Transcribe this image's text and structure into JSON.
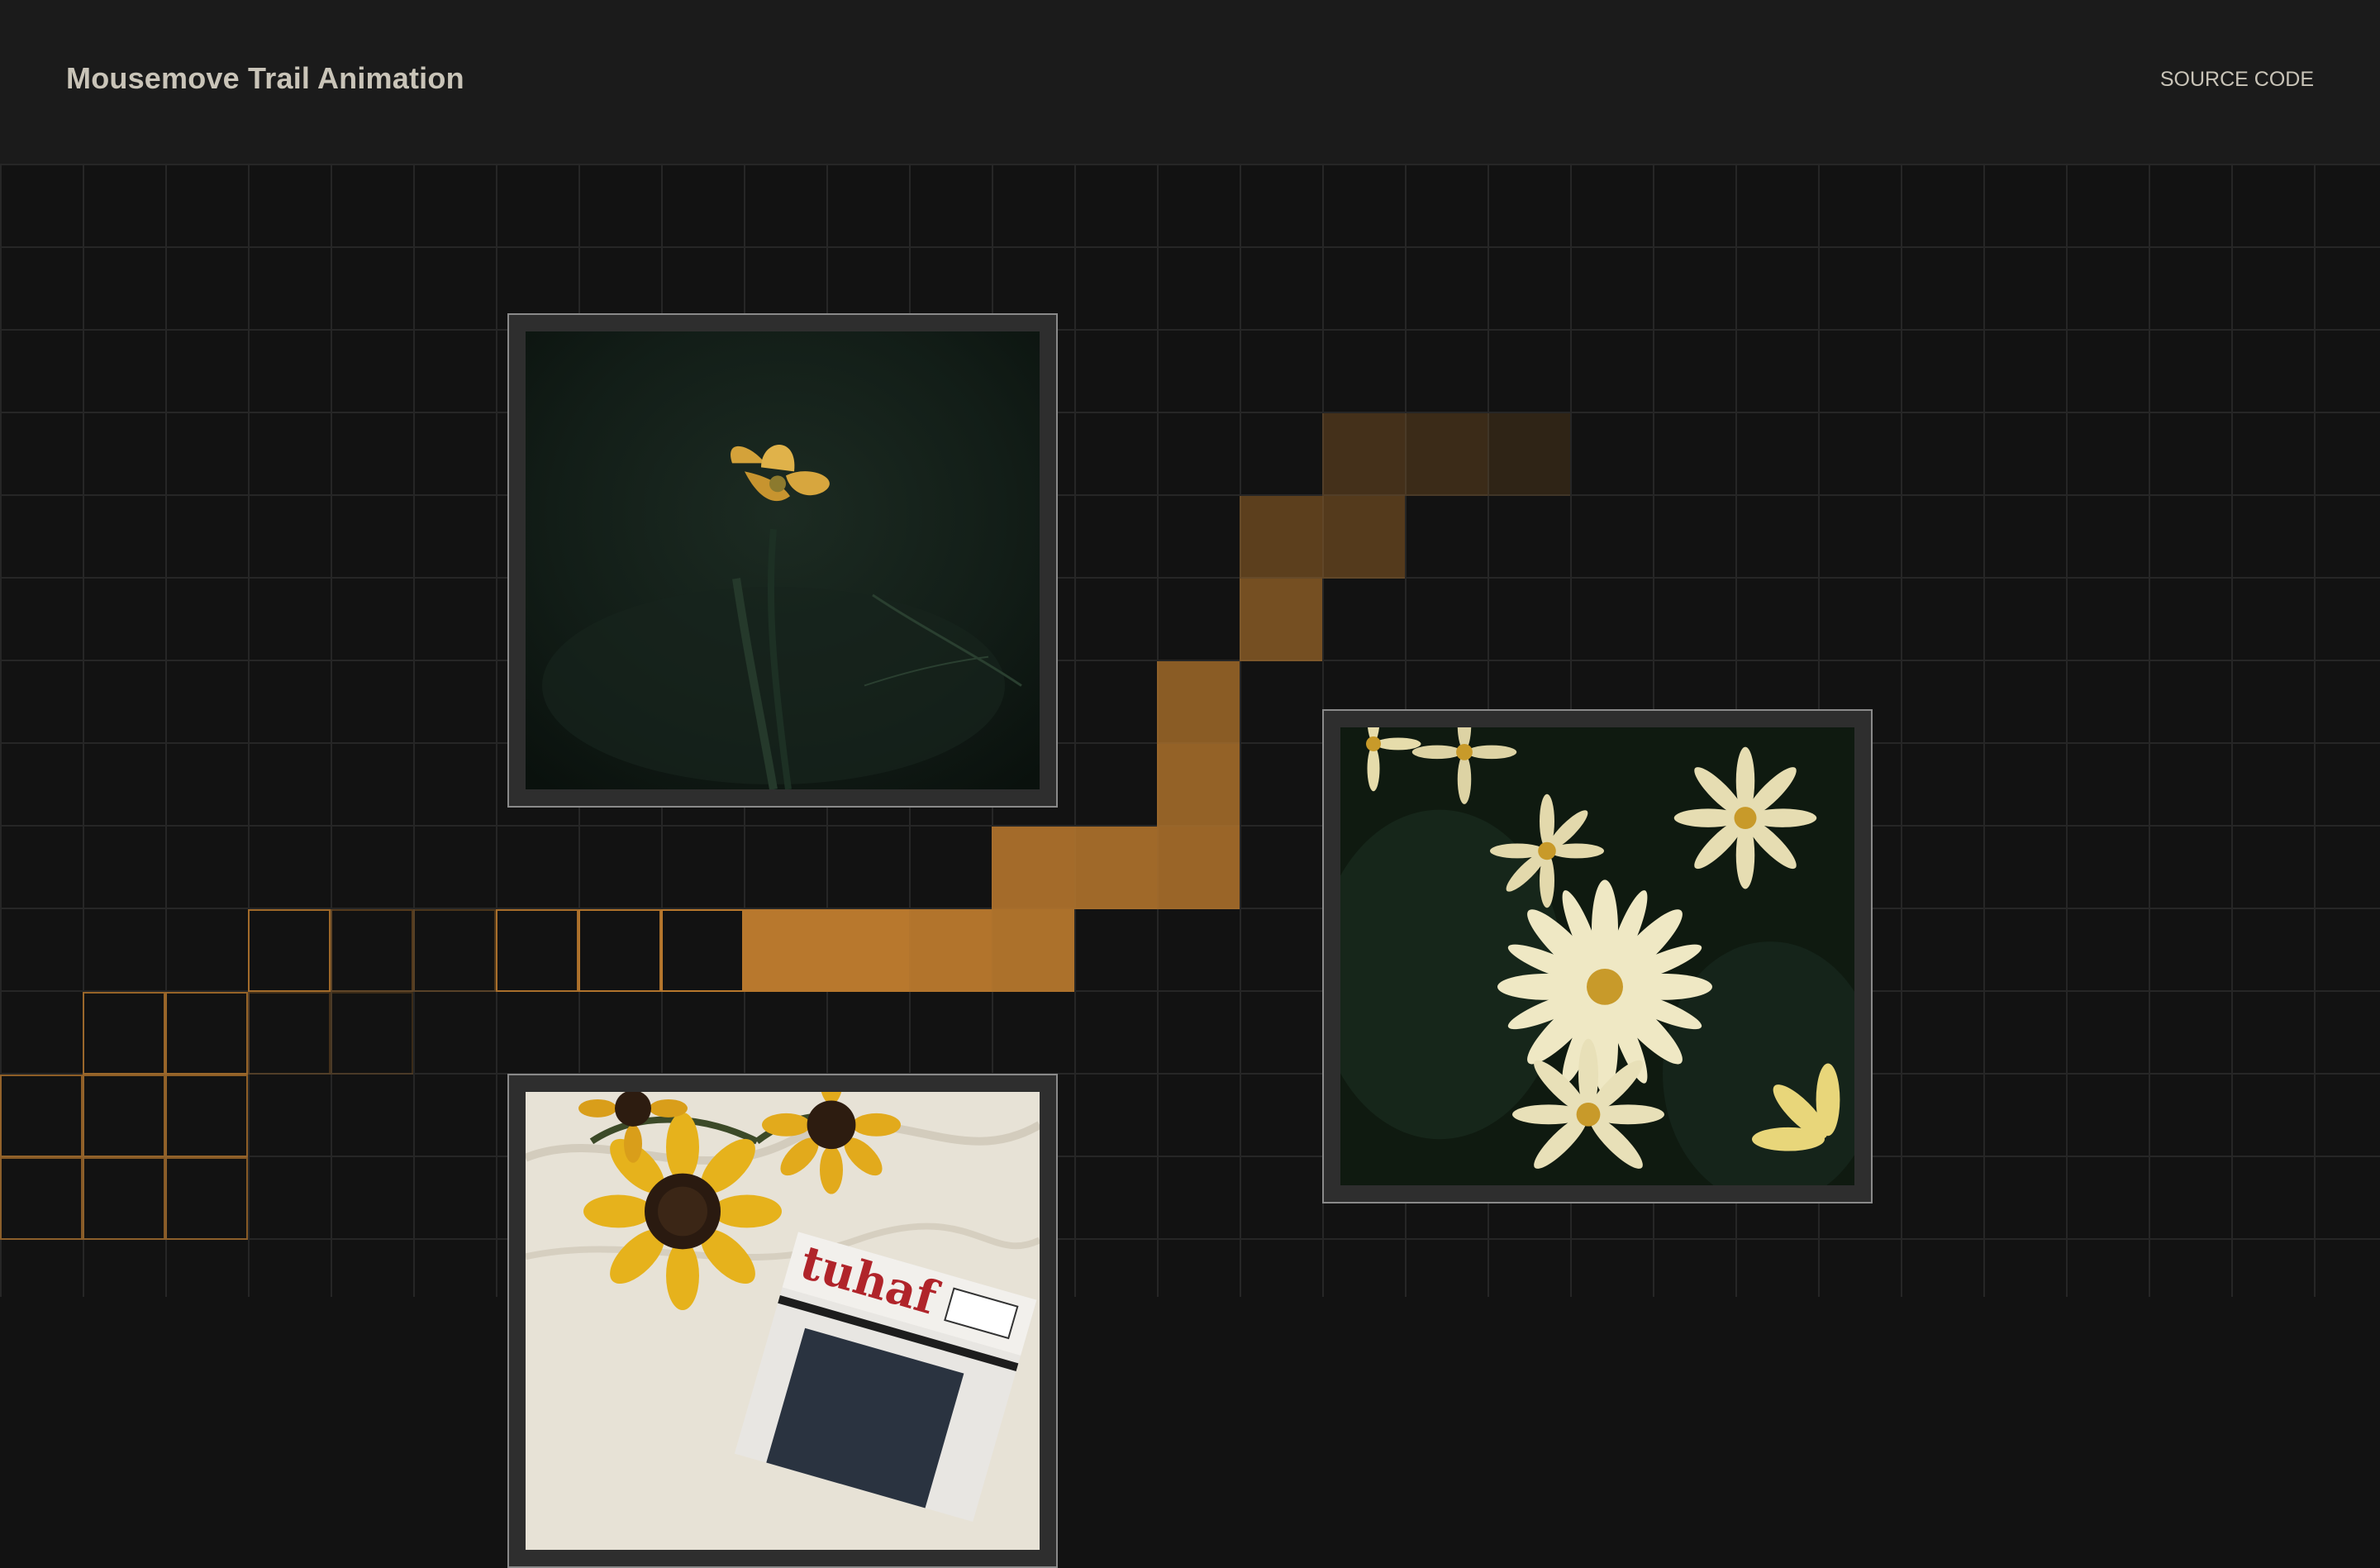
{
  "header": {
    "title": "Mousemove Trail Animation",
    "source_link": "SOURCE CODE"
  },
  "theme": {
    "background": "#121212",
    "header_background": "#1b1b1b",
    "grid_line": "#262626",
    "accent": "#b8782d",
    "text": "#c9c4b8"
  },
  "gallery": {
    "images": [
      {
        "subject": "yellow buttercup flower on dark green background"
      },
      {
        "subject": "white daisies with water droplets"
      },
      {
        "subject": "sunflowers on white sheet with magazine"
      }
    ]
  },
  "trail": {
    "filled_cells": [
      {
        "col": 16,
        "row": 3,
        "opacity": 0.3
      },
      {
        "col": 17,
        "row": 3,
        "opacity": 0.25
      },
      {
        "col": 18,
        "row": 3,
        "opacity": 0.18
      },
      {
        "col": 15,
        "row": 4,
        "opacity": 0.45
      },
      {
        "col": 16,
        "row": 4,
        "opacity": 0.4
      },
      {
        "col": 15,
        "row": 5,
        "opacity": 0.6
      },
      {
        "col": 14,
        "row": 6,
        "opacity": 0.72
      },
      {
        "col": 14,
        "row": 7,
        "opacity": 0.78
      },
      {
        "col": 12,
        "row": 8,
        "opacity": 0.88
      },
      {
        "col": 13,
        "row": 8,
        "opacity": 0.86
      },
      {
        "col": 14,
        "row": 8,
        "opacity": 0.82
      },
      {
        "col": 9,
        "row": 9,
        "opacity": 1.0
      },
      {
        "col": 10,
        "row": 9,
        "opacity": 1.0
      },
      {
        "col": 11,
        "row": 9,
        "opacity": 0.97
      },
      {
        "col": 12,
        "row": 9,
        "opacity": 0.93
      }
    ],
    "outlined_cells": [
      {
        "col": 3,
        "row": 9,
        "opacity": 0.85
      },
      {
        "col": 4,
        "row": 9,
        "opacity": 0.4
      },
      {
        "col": 5,
        "row": 9,
        "opacity": 0.35
      },
      {
        "col": 6,
        "row": 9,
        "opacity": 0.9
      },
      {
        "col": 7,
        "row": 9,
        "opacity": 0.95
      },
      {
        "col": 8,
        "row": 9,
        "opacity": 1.0
      },
      {
        "col": 1,
        "row": 10,
        "opacity": 0.8
      },
      {
        "col": 2,
        "row": 10,
        "opacity": 0.8
      },
      {
        "col": 3,
        "row": 10,
        "opacity": 0.3
      },
      {
        "col": 4,
        "row": 10,
        "opacity": 0.25
      },
      {
        "col": 0,
        "row": 11,
        "opacity": 0.75
      },
      {
        "col": 1,
        "row": 11,
        "opacity": 0.75
      },
      {
        "col": 2,
        "row": 11,
        "opacity": 0.75
      },
      {
        "col": 0,
        "row": 12,
        "opacity": 0.7
      },
      {
        "col": 1,
        "row": 12,
        "opacity": 0.7
      },
      {
        "col": 2,
        "row": 12,
        "opacity": 0.7
      }
    ]
  }
}
